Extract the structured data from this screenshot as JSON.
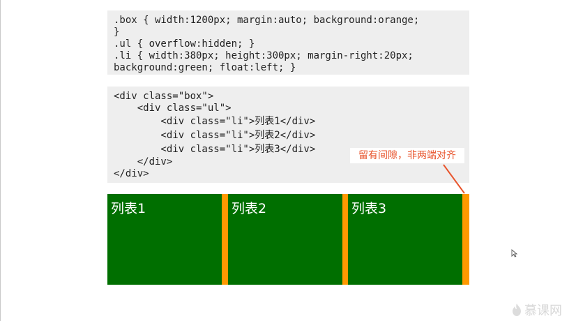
{
  "css_code": {
    "lines": [
      ".box { width:1200px; margin:auto; background:orange;",
      "}",
      ".ul { overflow:hidden; }",
      ".li { width:380px; height:300px; margin-right:20px;",
      "background:green; float:left; }"
    ]
  },
  "html_code": {
    "lines": [
      "<div class=\"box\">",
      "    <div class=\"ul\">",
      "        <div class=\"li\">列表1</div>",
      "        <div class=\"li\">列表2</div>",
      "        <div class=\"li\">列表3</div>",
      "    </div>",
      "</div>"
    ]
  },
  "annotation": {
    "text": "留有间隙，非两端对齐",
    "color": "#e8542c"
  },
  "demo": {
    "box_color": "#ff9900",
    "item_color": "#006f00",
    "items": [
      {
        "label": "列表1"
      },
      {
        "label": "列表2"
      },
      {
        "label": "列表3"
      }
    ]
  },
  "logo": {
    "text": "慕课网",
    "icon": "flame-icon"
  }
}
